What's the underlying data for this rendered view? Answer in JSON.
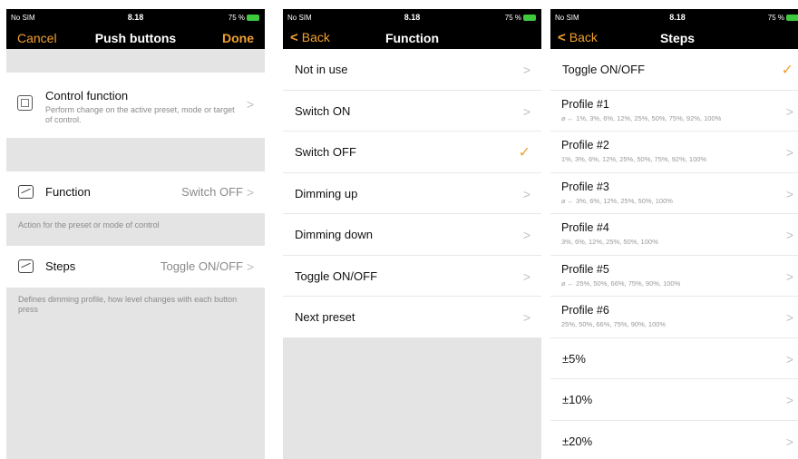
{
  "status_bar": {
    "carrier": "No SIM",
    "time": "8.18",
    "battery_s1": "75 %",
    "battery_s2": "75 %",
    "battery_s3": "75 %"
  },
  "screen1": {
    "nav": {
      "cancel": "Cancel",
      "title": "Push buttons",
      "done": "Done"
    },
    "control_function": {
      "title": "Control function",
      "description": "Perform change on the active preset, mode or target of control."
    },
    "function_row": {
      "label": "Function",
      "value": "Switch OFF"
    },
    "function_note": "Action for the preset or mode of control",
    "steps_row": {
      "label": "Steps",
      "value": "Toggle ON/OFF"
    },
    "steps_note": "Defines dimming profile, how level changes with each button press"
  },
  "screen2": {
    "nav": {
      "back": "Back",
      "title": "Function"
    },
    "items": [
      {
        "label": "Not in use",
        "checked": false
      },
      {
        "label": "Switch ON",
        "checked": false
      },
      {
        "label": "Switch OFF",
        "checked": true
      },
      {
        "label": "Dimming up",
        "checked": false
      },
      {
        "label": "Dimming down",
        "checked": false
      },
      {
        "label": "Toggle ON/OFF",
        "checked": false
      },
      {
        "label": "Next preset",
        "checked": false
      }
    ]
  },
  "screen3": {
    "nav": {
      "back": "Back",
      "title": "Steps"
    },
    "items": [
      {
        "label": "Toggle ON/OFF",
        "sub": "",
        "checked": true
      },
      {
        "label": "Profile #1",
        "sub": "⌀ ← 1%, 3%, 6%, 12%, 25%, 50%, 75%, 92%, 100%",
        "checked": false
      },
      {
        "label": "Profile #2",
        "sub": "1%, 3%, 6%, 12%, 25%, 50%, 75%, 92%, 100%",
        "checked": false
      },
      {
        "label": "Profile #3",
        "sub": "⌀ ← 3%, 6%, 12%, 25%, 50%, 100%",
        "checked": false
      },
      {
        "label": "Profile #4",
        "sub": "3%, 6%, 12%, 25%, 50%, 100%",
        "checked": false
      },
      {
        "label": "Profile #5",
        "sub": "⌀ ← 25%, 50%, 66%, 75%, 90%, 100%",
        "checked": false
      },
      {
        "label": "Profile #6",
        "sub": "25%, 50%, 66%, 75%, 90%, 100%",
        "checked": false
      },
      {
        "label": "±5%",
        "sub": "",
        "checked": false
      },
      {
        "label": "±10%",
        "sub": "",
        "checked": false
      },
      {
        "label": "±20%",
        "sub": "",
        "checked": false
      }
    ]
  },
  "icons": {
    "chevron": "chevron-right-icon",
    "check": "checkmark-icon",
    "back": "chevron-left-icon"
  },
  "colors": {
    "accent": "#f0a030",
    "nav_bg": "#000000",
    "group_bg": "#e4e4e4"
  }
}
